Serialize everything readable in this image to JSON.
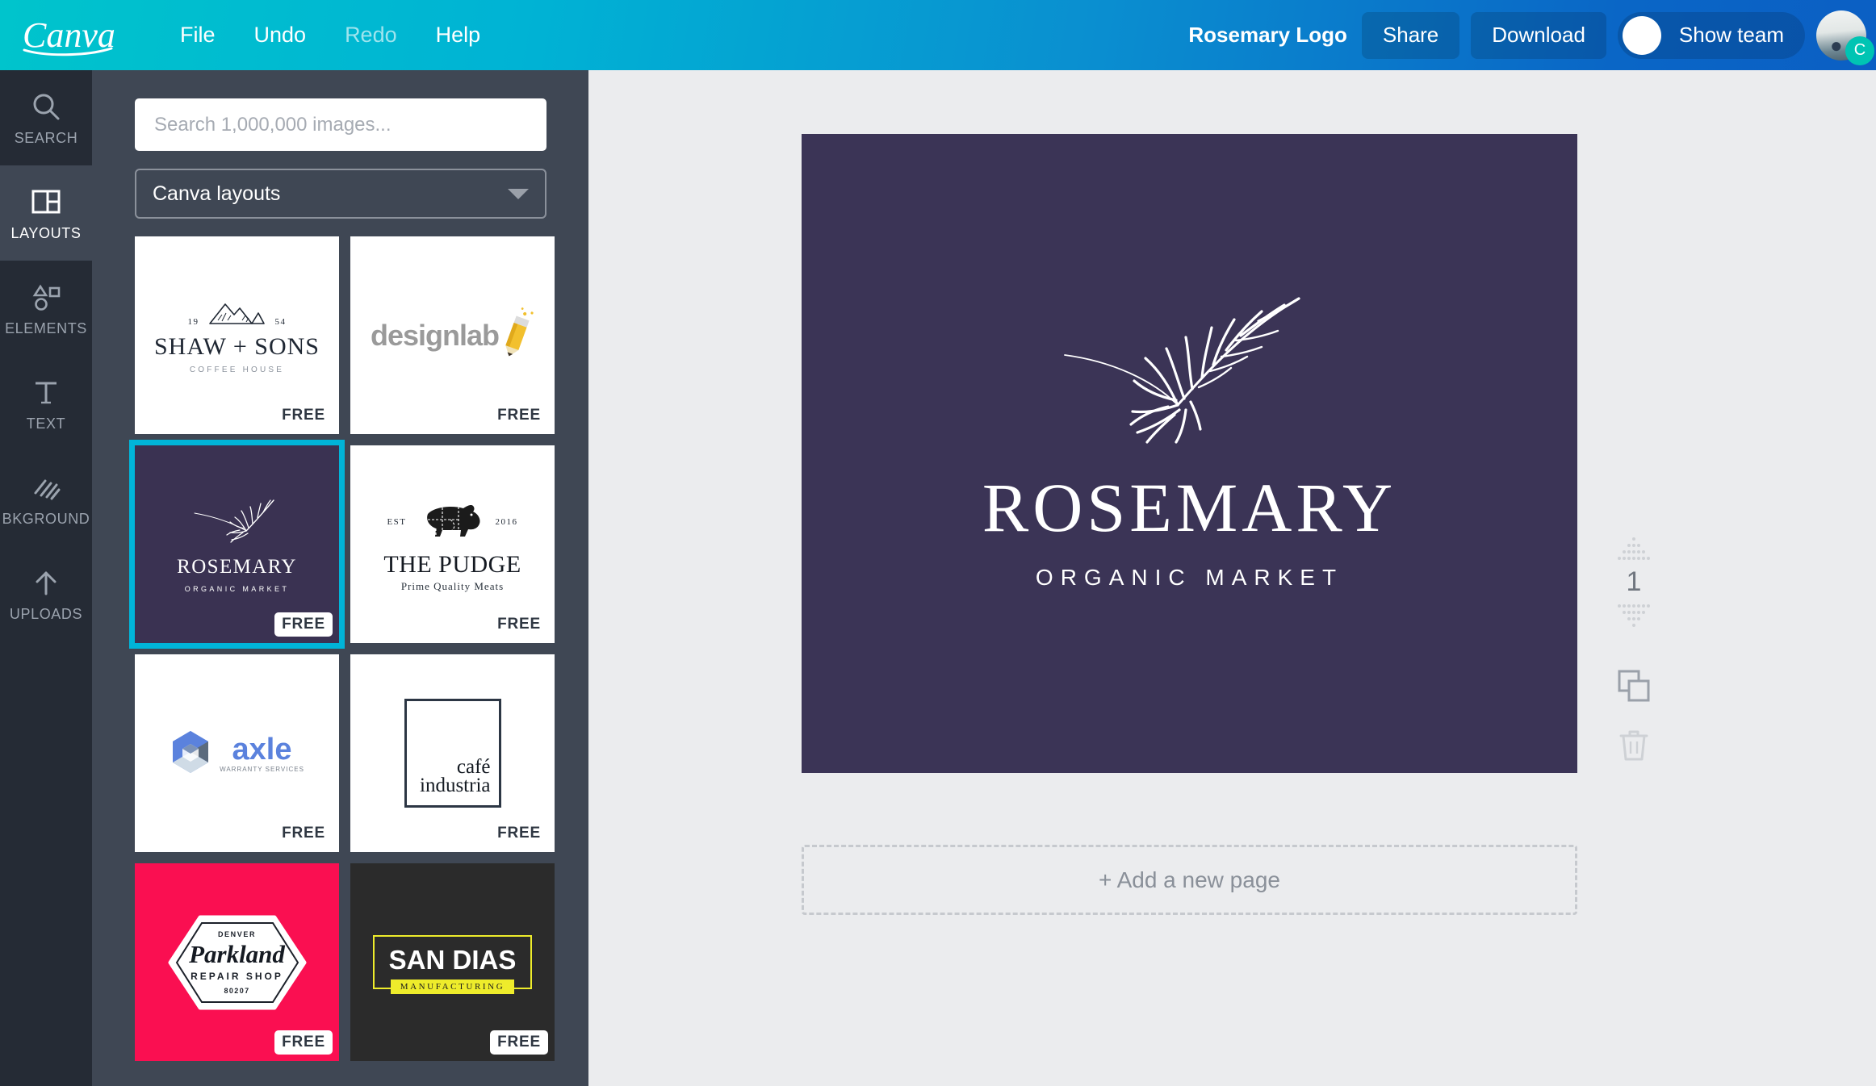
{
  "header": {
    "logo_text": "Canva",
    "menu": [
      {
        "label": "File",
        "dim": false
      },
      {
        "label": "Undo",
        "dim": false
      },
      {
        "label": "Redo",
        "dim": true
      },
      {
        "label": "Help",
        "dim": false
      }
    ],
    "doc_title": "Rosemary Logo",
    "share_label": "Share",
    "download_label": "Download",
    "show_team_label": "Show team",
    "avatar_badge_letter": "C",
    "gradient_start": "#00c4cc",
    "gradient_end": "#0b5fc4"
  },
  "rail": {
    "items": [
      {
        "label": "SEARCH",
        "icon": "search-icon",
        "active": false
      },
      {
        "label": "LAYOUTS",
        "icon": "layouts-icon",
        "active": true
      },
      {
        "label": "ELEMENTS",
        "icon": "elements-icon",
        "active": false
      },
      {
        "label": "TEXT",
        "icon": "text-icon",
        "active": false
      },
      {
        "label": "BKGROUND",
        "icon": "background-icon",
        "active": false
      },
      {
        "label": "UPLOADS",
        "icon": "uploads-icon",
        "active": false
      }
    ],
    "active_color": "#3f4754"
  },
  "panel": {
    "search_placeholder": "Search 1,000,000 images...",
    "search_value": "",
    "category_selected": "Canva layouts",
    "caret_icon": "chevron-down-icon",
    "free_label": "FREE",
    "selection_color": "#00b4d8",
    "thumbnails": [
      {
        "id": "shaw-sons",
        "name": "SHAW + SONS",
        "sub": "COFFEE HOUSE",
        "year_left": "19",
        "year_right": "54",
        "badge": "FREE",
        "selected": false,
        "bg": "#ffffff"
      },
      {
        "id": "designlab",
        "name": "designlab",
        "badge": "FREE",
        "selected": false,
        "bg": "#ffffff"
      },
      {
        "id": "rosemary",
        "name": "ROSEMARY",
        "sub": "ORGANIC MARKET",
        "badge": "FREE",
        "selected": true,
        "bg": "#3a3252"
      },
      {
        "id": "the-pudge",
        "name": "THE PUDGE",
        "sub": "Prime Quality Meats",
        "est_left": "EST",
        "est_right": "2016",
        "badge": "FREE",
        "selected": false,
        "bg": "#ffffff"
      },
      {
        "id": "axle",
        "name": "axle",
        "sub": "WARRANTY SERVICES",
        "badge": "FREE",
        "selected": false,
        "bg": "#ffffff"
      },
      {
        "id": "cafe-industria",
        "name_line1": "café",
        "name_line2": "industria",
        "badge": "FREE",
        "selected": false,
        "bg": "#ffffff"
      },
      {
        "id": "parkland",
        "city": "DENVER",
        "name": "Parkland",
        "sub": "REPAIR SHOP",
        "zip": "80207",
        "badge": "FREE",
        "selected": false,
        "bg": "#fa0f51"
      },
      {
        "id": "san-dias",
        "name": "SAN DIAS",
        "sub": "MANUFACTURING",
        "badge": "FREE",
        "selected": false,
        "bg": "#2b2b2b"
      }
    ]
  },
  "canvas": {
    "background": "#3b3456",
    "logo_title": "ROSEMARY",
    "logo_subtitle": "ORGANIC MARKET",
    "sprig_icon": "rosemary-sprig-icon"
  },
  "page_tools": {
    "move_up_icon": "move-up-icon",
    "page_number": "1",
    "move_down_icon": "move-down-icon",
    "duplicate_icon": "duplicate-page-icon",
    "delete_icon": "trash-icon"
  },
  "add_page": {
    "label": "+ Add a new page"
  }
}
